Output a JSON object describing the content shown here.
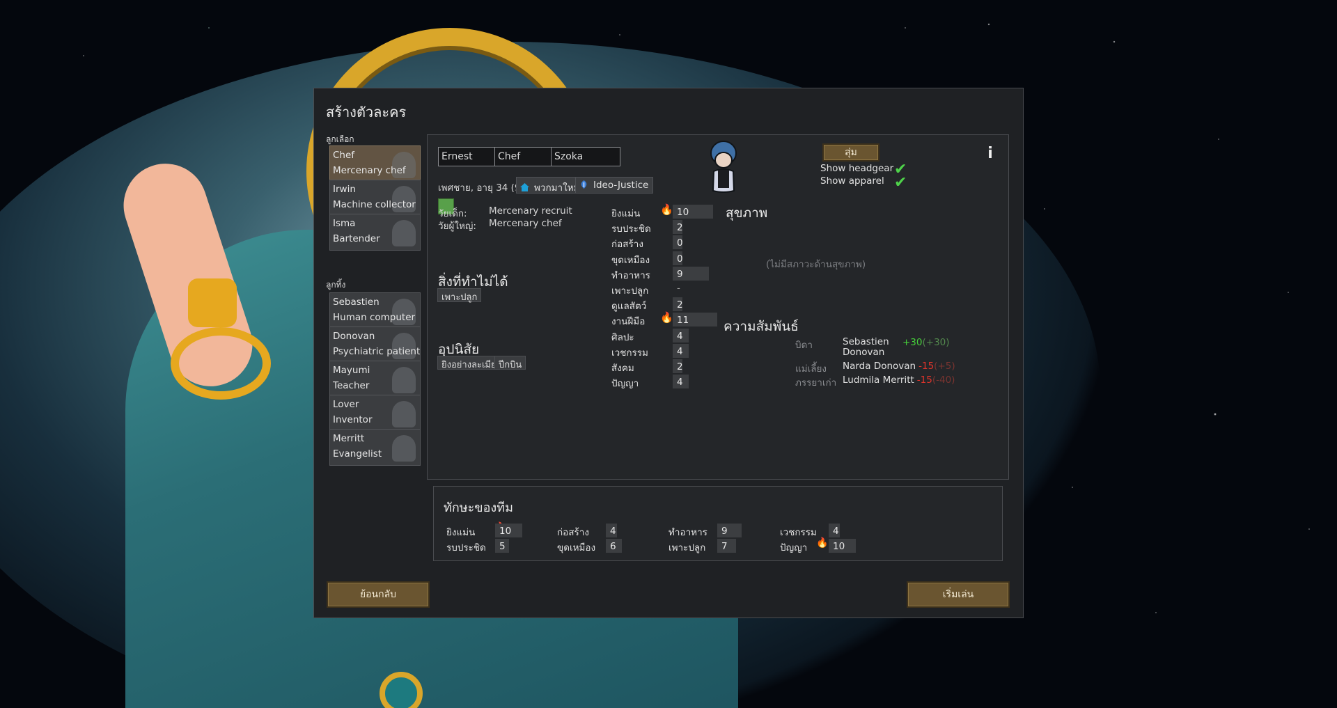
{
  "dialog": {
    "title": "สร้างตัวละคร",
    "chosen_label": "ลูกเลือก",
    "left_label": "ลูกทิ้ง"
  },
  "chosen_pawns": [
    {
      "name": "Chef",
      "title": "Mercenary chef",
      "selected": true
    },
    {
      "name": "Irwin",
      "title": "Machine collector"
    },
    {
      "name": "Isma",
      "title": "Bartender"
    }
  ],
  "left_pawns": [
    {
      "name": "Sebastien",
      "title": "Human computer"
    },
    {
      "name": "Donovan",
      "title": "Psychiatric patient"
    },
    {
      "name": "Mayumi",
      "title": "Teacher"
    },
    {
      "name": "Lover",
      "title": "Inventor"
    },
    {
      "name": "Merritt",
      "title": "Evangelist"
    }
  ],
  "pawn": {
    "first_name": "Ernest",
    "nick_name": "Chef",
    "last_name": "Szoka",
    "desc": "เพศชาย, อายุ 34 (90)",
    "faction": "พวกมาใหม่",
    "ideo": "Ideo-Justice",
    "favorite_color": "#58a04a",
    "childhood_label": "วัยเด็ก:",
    "childhood": "Mercenary recruit",
    "adulthood_label": "วัยผู้ใหญ่:",
    "adulthood": "Mercenary chef",
    "incapable_title": "สิ่งที่ทำไม่ได้",
    "incapable": [
      "เพาะปลูก"
    ],
    "traits_title": "อุปนิสัย",
    "traits": [
      "ยิงอย่างละเมียด",
      "ปีกบิน"
    ],
    "health_title": "สุขภาพ",
    "health_empty": "(ไม่มีสภาวะด้านสุขภาพ)",
    "relations_title": "ความสัมพันธ์"
  },
  "buttons": {
    "randomize": "สุ่ม",
    "info_icon": "info-icon",
    "show_headgear": "Show headgear",
    "show_apparel": "Show apparel",
    "back": "ย้อนกลับ",
    "start": "เริ่มเล่น"
  },
  "skills": [
    {
      "name": "ยิงแม่น",
      "value": "10",
      "passion": 2,
      "level": 10
    },
    {
      "name": "รบประชิด",
      "value": "2",
      "passion": 0,
      "level": 2
    },
    {
      "name": "ก่อสร้าง",
      "value": "0",
      "passion": 0,
      "level": 0
    },
    {
      "name": "ขุดเหมือง",
      "value": "0",
      "passion": 0,
      "level": 0
    },
    {
      "name": "ทำอาหาร",
      "value": "9",
      "passion": 0,
      "level": 9
    },
    {
      "name": "เพาะปลูก",
      "value": "-",
      "passion": 0,
      "level": 0,
      "disabled": true
    },
    {
      "name": "ดูแลสัตว์",
      "value": "2",
      "passion": 0,
      "level": 2
    },
    {
      "name": "งานฝีมือ",
      "value": "11",
      "passion": 2,
      "level": 11
    },
    {
      "name": "ศิลปะ",
      "value": "4",
      "passion": 0,
      "level": 4
    },
    {
      "name": "เวชกรรม",
      "value": "4",
      "passion": 0,
      "level": 4
    },
    {
      "name": "สังคม",
      "value": "2",
      "passion": 0,
      "level": 2
    },
    {
      "name": "ปัญญา",
      "value": "4",
      "passion": 0,
      "level": 4
    }
  ],
  "relations": [
    {
      "kind": "บิดา",
      "name": "Sebastien Donovan",
      "opinion": "+30",
      "their": "(+30)",
      "positive": true
    },
    {
      "kind": "แม่เลี้ยง",
      "name": "Narda Donovan",
      "opinion": "-15",
      "their": "(+5)",
      "positive": false
    },
    {
      "kind": "ภรรยาเก่า",
      "name": "Ludmila Merritt",
      "opinion": "-15",
      "their": "(-40)",
      "positive": false
    }
  ],
  "team": {
    "title": "ทักษะของทีม",
    "skills": [
      {
        "name": "ยิงแม่น",
        "value": "10",
        "passion": 2,
        "level": 10
      },
      {
        "name": "รบประชิด",
        "value": "5",
        "passion": 1,
        "level": 5
      },
      {
        "name": "ก่อสร้าง",
        "value": "4",
        "passion": 0,
        "level": 4
      },
      {
        "name": "ขุดเหมือง",
        "value": "6",
        "passion": 1,
        "level": 6
      },
      {
        "name": "ทำอาหาร",
        "value": "9",
        "passion": 0,
        "level": 9
      },
      {
        "name": "เพาะปลูก",
        "value": "7",
        "passion": 1,
        "level": 7
      },
      {
        "name": "เวชกรรม",
        "value": "4",
        "passion": 0,
        "level": 4
      },
      {
        "name": "ปัญญา",
        "value": "10",
        "passion": 2,
        "level": 10
      }
    ]
  }
}
